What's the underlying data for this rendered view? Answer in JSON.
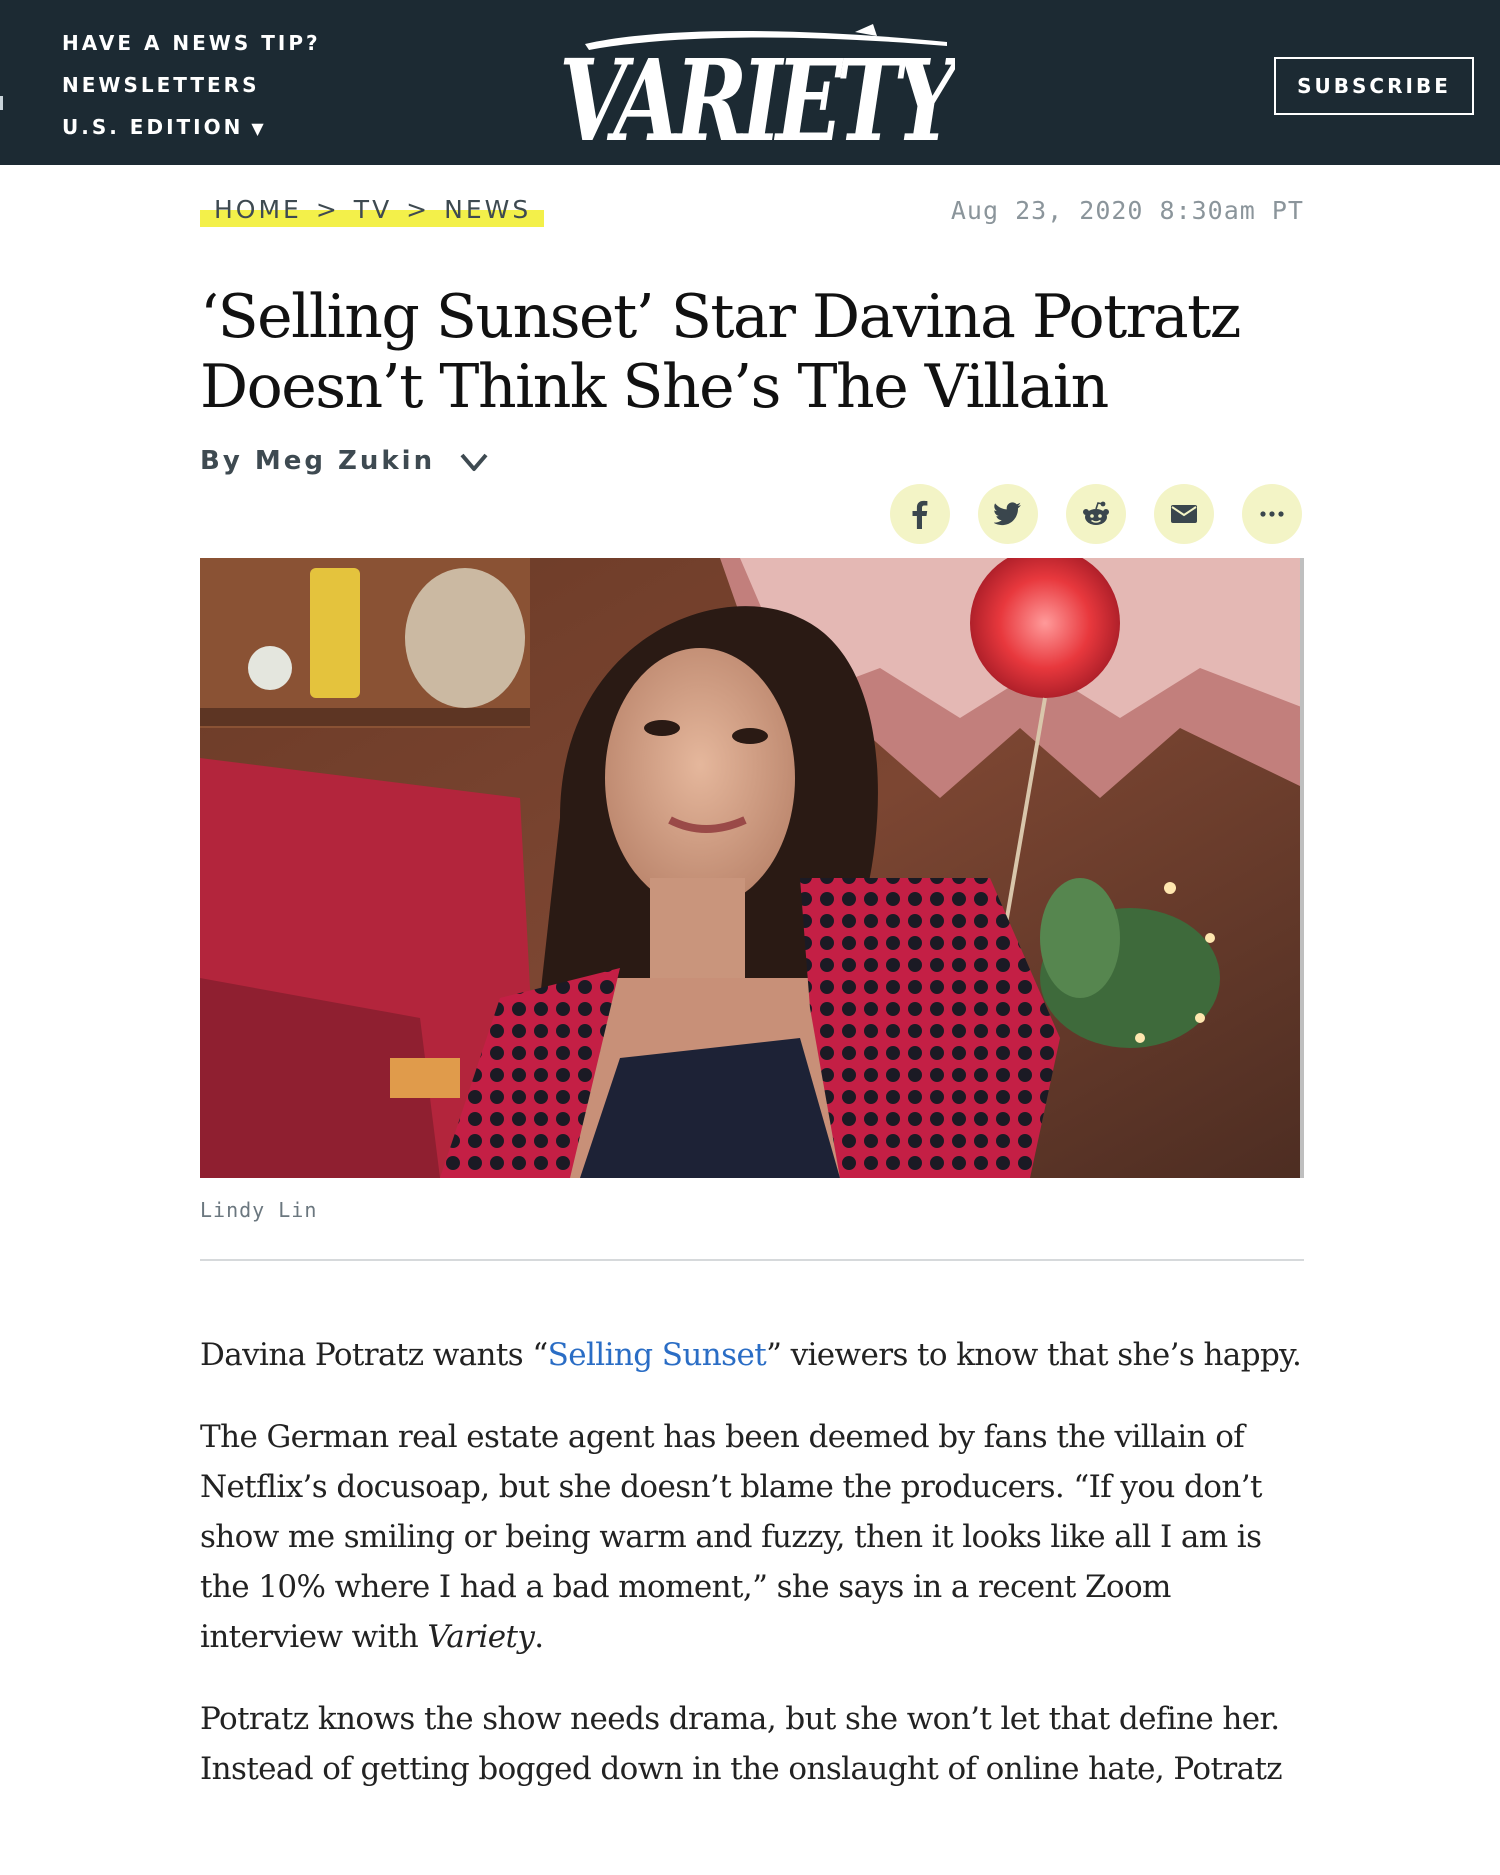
{
  "header": {
    "nav_links": [
      {
        "label": "HAVE A NEWS TIP?"
      },
      {
        "label": "NEWSLETTERS"
      },
      {
        "label": "U.S. EDITION"
      }
    ],
    "edition_caret": "▼",
    "logo_text": "VARIETY",
    "subscribe_label": "SUBSCRIBE",
    "background_color": "#1c2a33"
  },
  "breadcrumb": {
    "items": [
      "HOME",
      "TV",
      "NEWS"
    ],
    "separator": ">",
    "highlight_color": "#f3f04a"
  },
  "timestamp": "Aug 23, 2020 8:30am PT",
  "article": {
    "headline_line1": "‘Selling Sunset’ Star Davina Potratz",
    "headline_line2": "Doesn’t Think She’s The Villain",
    "byline_prefix": "By",
    "author": "Meg Zukin",
    "share_icons": [
      "facebook-icon",
      "twitter-icon",
      "reddit-icon",
      "email-icon",
      "more-icon"
    ],
    "share_button_color": "#f3f4c6",
    "photo_credit": "Lindy Lin",
    "paragraphs": {
      "p1_before": "Davina Potratz wants “",
      "p1_link": "Selling Sunset",
      "p1_after": "” viewers to know that she’s happy.",
      "p2_text": "The German real estate agent has been deemed by fans the villain of Netflix’s docusoap, but she doesn’t blame the producers. “If you don’t show me smiling or being warm and fuzzy, then it looks like all I am is the 10% where I had a bad moment,” she says in a recent Zoom interview with ",
      "p2_italic": "Variety",
      "p2_end": ".",
      "p3_text": "Potratz knows the show needs drama, but she won’t let that define her. Instead of getting bogged down in the onslaught of online hate, Potratz"
    },
    "link_color": "#2a6dc5"
  }
}
